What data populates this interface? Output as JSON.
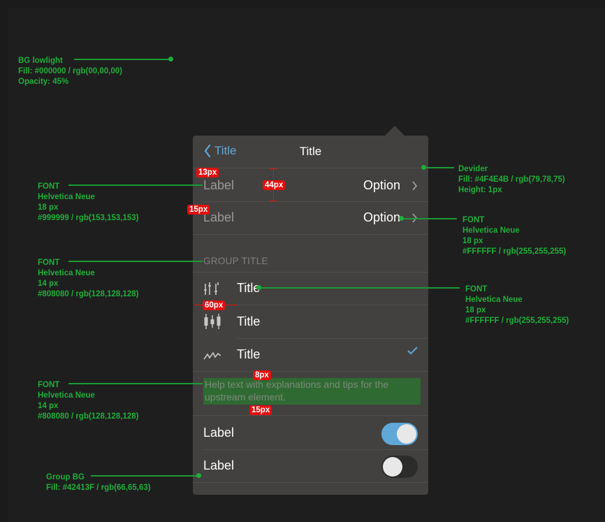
{
  "annotations": {
    "bg_lowlight": {
      "line1": "BG lowlight",
      "line2": "Fill: #000000 / rgb(00,00,00)",
      "line3": "Opacity: 45%"
    },
    "font_label": {
      "line1": "FONT",
      "line2": "Helvetica Neue",
      "line3": "18 px",
      "line4": "#999999 / rgb(153,153,153)"
    },
    "font_group": {
      "line1": "FONT",
      "line2": "Helvetica Neue",
      "line3": "14 px",
      "line4": "#808080 / rgb(128,128,128)"
    },
    "font_help": {
      "line1": "FONT",
      "line2": "Helvetica Neue",
      "line3": "14 px",
      "line4": "#808080 / rgb(128,128,128)"
    },
    "group_bg": {
      "line1": "Group BG",
      "line2": "Fill: #42413F / rgb(66,65,63)"
    },
    "divider": {
      "line1": "Devider",
      "line2": "Fill: #4F4E4B / rgb(79,78,75)",
      "line3": "Height: 1px"
    },
    "font_option": {
      "line1": "FONT",
      "line2": "Helvetica Neue",
      "line3": "18 px",
      "line4": "#FFFFFF / rgb(255,255,255)"
    },
    "font_title": {
      "line1": "FONT",
      "line2": "Helvetica Neue",
      "line3": "18 px",
      "line4": "#FFFFFF / rgb(255,255,255)"
    }
  },
  "measures": {
    "m13": "13px",
    "m44": "44px",
    "m15a": "15px",
    "m60": "60px",
    "m8": "8px",
    "m15b": "15px"
  },
  "popover": {
    "back_label": "Title",
    "title": "Title",
    "rows": [
      {
        "label": "Label",
        "option": "Option"
      },
      {
        "label": "Label",
        "option": "Option"
      }
    ],
    "group_title": "GROUP TITLE",
    "list": [
      {
        "title": "Title",
        "icon": "tuning-icon"
      },
      {
        "title": "Title",
        "icon": "candlestick-icon"
      },
      {
        "title": "Title",
        "icon": "line-chart-icon",
        "checked": true
      }
    ],
    "help_text": "Help text with explanations and tips for the upstream element.",
    "toggles": [
      {
        "label": "Label",
        "on": true
      },
      {
        "label": "Label",
        "on": false
      }
    ]
  },
  "colors": {
    "accent": "#5fa8d8",
    "group_bg": "#42413f",
    "divider": "#4f4e4b",
    "annotation": "#1fae3a",
    "measure": "#e31010"
  }
}
